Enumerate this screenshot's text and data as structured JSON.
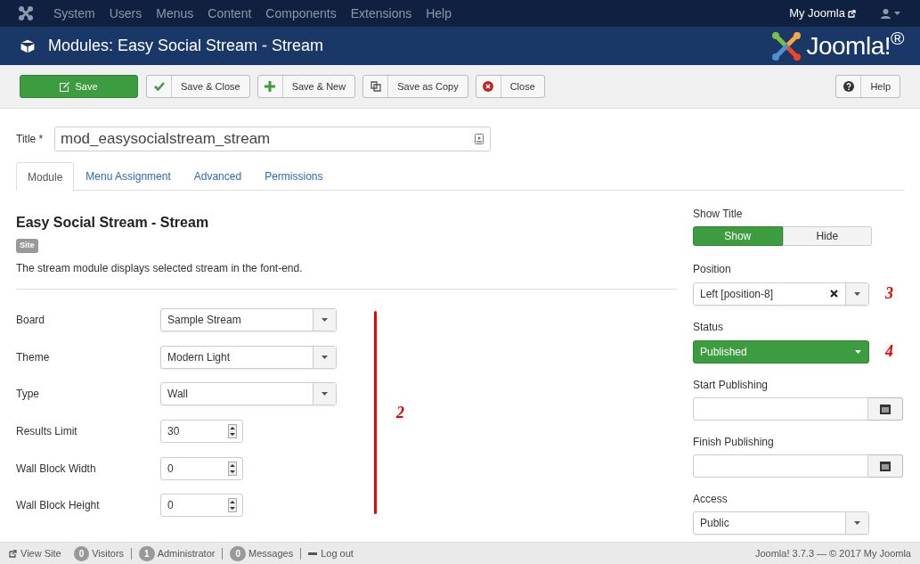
{
  "top_menu": {
    "items": [
      "System",
      "Users",
      "Menus",
      "Content",
      "Components",
      "Extensions",
      "Help"
    ],
    "site_link": "My Joomla"
  },
  "header": {
    "title": "Modules: Easy Social Stream - Stream",
    "logo_text": "Joomla!$^{®}$"
  },
  "toolbar": {
    "buttons": [
      {
        "label": "Save",
        "kind": "primary"
      },
      {
        "label": "Save & Close",
        "kind": "check"
      },
      {
        "label": "Save & New",
        "kind": "plus"
      },
      {
        "label": "Save as Copy",
        "kind": "copy"
      },
      {
        "label": "Close",
        "kind": "close"
      }
    ],
    "help": {
      "label": "Help"
    }
  },
  "title_field": {
    "label": "Title *",
    "value": "mod_easysocialstream_stream"
  },
  "tabs": [
    {
      "label": "Module",
      "selected": true
    },
    {
      "label": "Menu Assignment",
      "selected": false
    },
    {
      "label": "Advanced",
      "selected": false
    },
    {
      "label": "Permissions",
      "selected": false
    }
  ],
  "module": {
    "heading": "Easy Social Stream - Stream",
    "badge": "Site",
    "description": "The stream module displays selected stream in the font-end."
  },
  "fields": [
    {
      "kind": "select",
      "label": "Board",
      "value": "Sample Stream"
    },
    {
      "kind": "select",
      "label": "Theme",
      "value": "Modern Light"
    },
    {
      "kind": "select",
      "label": "Type",
      "value": "Wall"
    },
    {
      "kind": "number",
      "label": "Results Limit",
      "value": "30"
    },
    {
      "kind": "number",
      "label": "Wall Block Width",
      "value": "0"
    },
    {
      "kind": "number",
      "label": "Wall Block Height",
      "value": "0"
    }
  ],
  "fields_annotation": "2",
  "sidebar": {
    "show_title": {
      "label": "Show Title",
      "options": [
        {
          "label": "Show",
          "selected": true
        },
        {
          "label": "Hide",
          "selected": false
        }
      ]
    },
    "position": {
      "label": "Position",
      "value": "Left [position-8]",
      "annotation": "3"
    },
    "status": {
      "label": "Status",
      "value": "Published",
      "annotation": "4"
    },
    "start_publishing": {
      "label": "Start Publishing"
    },
    "finish_publishing": {
      "label": "Finish Publishing"
    },
    "access": {
      "label": "Access",
      "value": "Public"
    }
  },
  "footer": {
    "view_site": "View Site",
    "counters": [
      {
        "count": "0",
        "label": "Visitors"
      },
      {
        "count": "1",
        "label": "Administrator"
      },
      {
        "count": "0",
        "label": "Messages"
      }
    ],
    "logout": "Log out",
    "version": "Joomla! 3.7.3 — © 2017 My Joomla"
  }
}
